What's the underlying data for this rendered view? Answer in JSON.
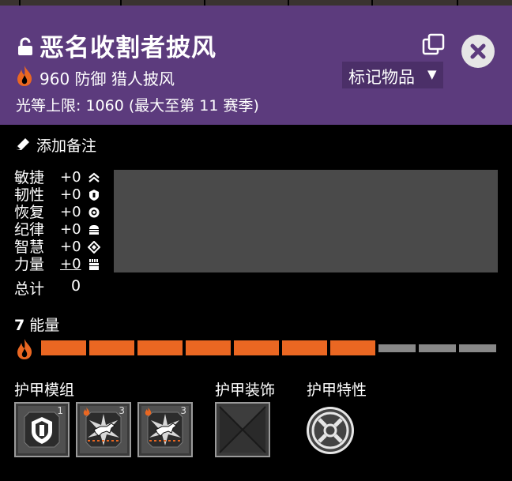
{
  "header": {
    "title": "恶名收割者披风",
    "power": "960",
    "item_desc": "防御 猎人披风",
    "tag_label": "标记物品",
    "power_cap": "光等上限: 1060 (最大至第 11 赛季)",
    "bg_color": "#5c3b7d"
  },
  "notes": {
    "label": "添加备注",
    "icon": "pencil-icon"
  },
  "stats": {
    "rows": [
      {
        "name": "敏捷",
        "value": "+0",
        "icon": "mobility-icon"
      },
      {
        "name": "韧性",
        "value": "+0",
        "icon": "resilience-icon"
      },
      {
        "name": "恢复",
        "value": "+0",
        "icon": "recovery-icon"
      },
      {
        "name": "纪律",
        "value": "+0",
        "icon": "discipline-icon"
      },
      {
        "name": "智慧",
        "value": "+0",
        "icon": "intellect-icon"
      },
      {
        "name": "力量",
        "value": "+0",
        "icon": "strength-icon"
      }
    ],
    "total_label": "总计",
    "total_value": "0"
  },
  "energy": {
    "capacity": "7",
    "label": "能量",
    "filled": 7,
    "total": 10,
    "fill_color": "#ea6722",
    "empty_color": "#888888"
  },
  "sections": {
    "mods": "护甲模组",
    "ornament": "护甲装饰",
    "perk": "护甲特性"
  },
  "mods": [
    {
      "cost": "1",
      "icon": "resilience-mod-icon"
    },
    {
      "cost": "3",
      "icon": "arc-dog-mod-icon"
    },
    {
      "cost": "3",
      "icon": "arc-dog-mod-icon"
    }
  ],
  "ornament": {
    "icon": "default-ornament-icon"
  },
  "perk": {
    "icon": "armor-perk-icon"
  }
}
